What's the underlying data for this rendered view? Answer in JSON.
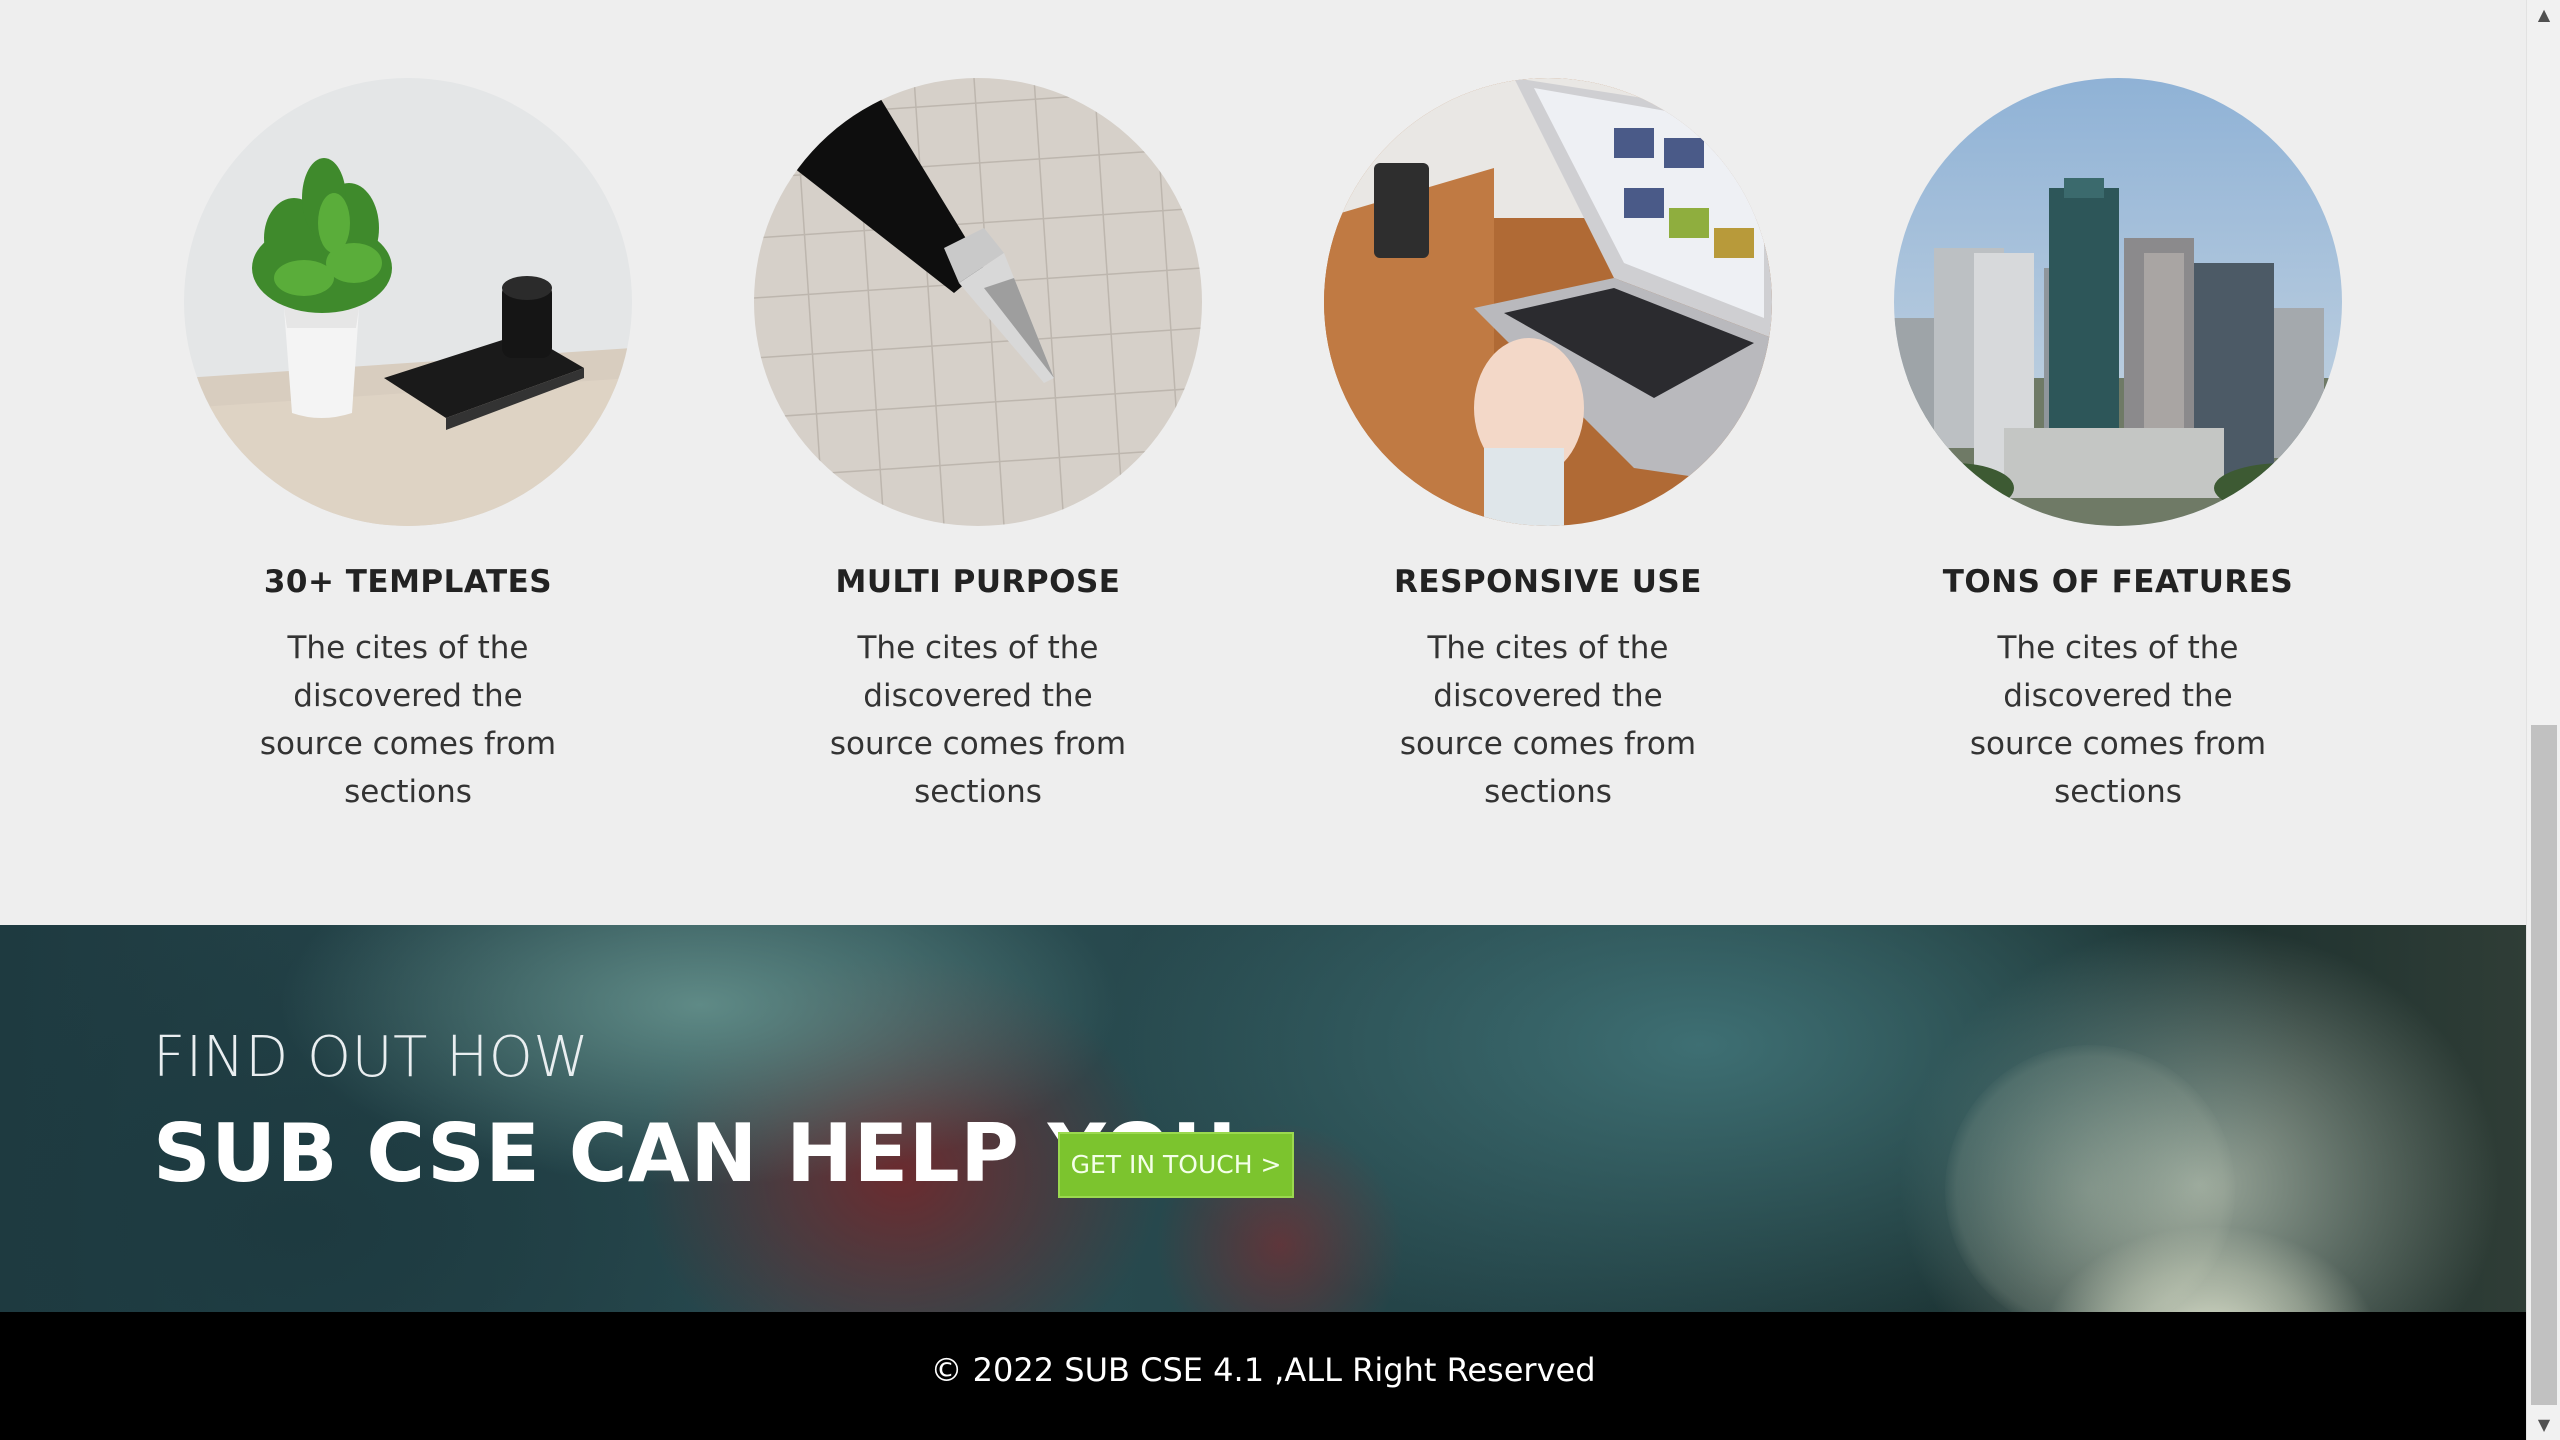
{
  "features": [
    {
      "image_icon": "plant-camera-photo",
      "title": "30+ TEMPLATES",
      "desc": "The cites of the discovered the source comes from sections"
    },
    {
      "image_icon": "fountain-pen-photo",
      "title": "MULTI PURPOSE",
      "desc": "The cites of the discovered the source comes from sections"
    },
    {
      "image_icon": "laptop-desk-photo",
      "title": "RESPONSIVE USE",
      "desc": "The cites of the discovered the source comes from sections"
    },
    {
      "image_icon": "city-skyline-photo",
      "title": "TONS OF FEATURES",
      "desc": "The cites of the discovered the source comes from sections"
    }
  ],
  "cta": {
    "line1": "FIND OUT HOW",
    "line2": "SUB CSE CAN HELP YOU",
    "button_label": "GET IN TOUCH >"
  },
  "footer": {
    "text": "© 2022 SUB CSE 4.1 ,ALL Right Reserved"
  },
  "colors": {
    "accent": "#7cc42e",
    "footer_bg": "#000000",
    "page_bg": "#eeeeee"
  }
}
